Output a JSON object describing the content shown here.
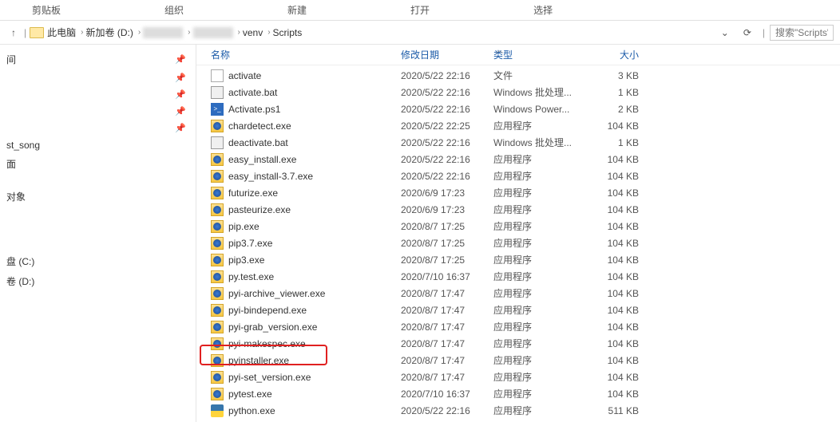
{
  "ribbon": [
    "剪贴板",
    "组织",
    "新建",
    "打开",
    "选择"
  ],
  "nav": {
    "segments": [
      "此电脑",
      "新加卷 (D:)",
      "",
      "",
      "venv",
      "Scripts"
    ],
    "search_placeholder": "搜索\"Scripts\""
  },
  "sidebar": {
    "items": [
      {
        "label": "间",
        "pin": true
      },
      {
        "label": "",
        "pin": true
      },
      {
        "label": "",
        "pin": true
      },
      {
        "label": "",
        "pin": true
      },
      {
        "label": "",
        "pin": true
      },
      {
        "label": "st_song",
        "pin": false
      },
      {
        "label": "面",
        "pin": false
      },
      {
        "label": "",
        "pin": false
      },
      {
        "label": "",
        "pin": false
      },
      {
        "label": "对象",
        "pin": false
      },
      {
        "label": "",
        "pin": false
      },
      {
        "label": "",
        "pin": false
      },
      {
        "label": "",
        "pin": false
      },
      {
        "label": "",
        "pin": false
      },
      {
        "label": "",
        "pin": false
      },
      {
        "label": "",
        "pin": false
      },
      {
        "label": "",
        "pin": false
      },
      {
        "label": "盘 (C:)",
        "pin": false
      },
      {
        "label": "卷 (D:)",
        "pin": false
      }
    ]
  },
  "columns": {
    "name": "名称",
    "date": "修改日期",
    "type": "类型",
    "size": "大小"
  },
  "files": [
    {
      "icon": "file",
      "name": "activate",
      "date": "2020/5/22 22:16",
      "type": "文件",
      "size": "3 KB"
    },
    {
      "icon": "bat",
      "name": "activate.bat",
      "date": "2020/5/22 22:16",
      "type": "Windows 批处理...",
      "size": "1 KB"
    },
    {
      "icon": "ps1",
      "name": "Activate.ps1",
      "date": "2020/5/22 22:16",
      "type": "Windows Power...",
      "size": "2 KB"
    },
    {
      "icon": "exe",
      "name": "chardetect.exe",
      "date": "2020/5/22 22:25",
      "type": "应用程序",
      "size": "104 KB"
    },
    {
      "icon": "bat",
      "name": "deactivate.bat",
      "date": "2020/5/22 22:16",
      "type": "Windows 批处理...",
      "size": "1 KB"
    },
    {
      "icon": "exe",
      "name": "easy_install.exe",
      "date": "2020/5/22 22:16",
      "type": "应用程序",
      "size": "104 KB"
    },
    {
      "icon": "exe",
      "name": "easy_install-3.7.exe",
      "date": "2020/5/22 22:16",
      "type": "应用程序",
      "size": "104 KB"
    },
    {
      "icon": "exe",
      "name": "futurize.exe",
      "date": "2020/6/9 17:23",
      "type": "应用程序",
      "size": "104 KB"
    },
    {
      "icon": "exe",
      "name": "pasteurize.exe",
      "date": "2020/6/9 17:23",
      "type": "应用程序",
      "size": "104 KB"
    },
    {
      "icon": "exe",
      "name": "pip.exe",
      "date": "2020/8/7 17:25",
      "type": "应用程序",
      "size": "104 KB"
    },
    {
      "icon": "exe",
      "name": "pip3.7.exe",
      "date": "2020/8/7 17:25",
      "type": "应用程序",
      "size": "104 KB"
    },
    {
      "icon": "exe",
      "name": "pip3.exe",
      "date": "2020/8/7 17:25",
      "type": "应用程序",
      "size": "104 KB"
    },
    {
      "icon": "exe",
      "name": "py.test.exe",
      "date": "2020/7/10 16:37",
      "type": "应用程序",
      "size": "104 KB"
    },
    {
      "icon": "exe",
      "name": "pyi-archive_viewer.exe",
      "date": "2020/8/7 17:47",
      "type": "应用程序",
      "size": "104 KB"
    },
    {
      "icon": "exe",
      "name": "pyi-bindepend.exe",
      "date": "2020/8/7 17:47",
      "type": "应用程序",
      "size": "104 KB"
    },
    {
      "icon": "exe",
      "name": "pyi-grab_version.exe",
      "date": "2020/8/7 17:47",
      "type": "应用程序",
      "size": "104 KB"
    },
    {
      "icon": "exe",
      "name": "pyi-makespec.exe",
      "date": "2020/8/7 17:47",
      "type": "应用程序",
      "size": "104 KB"
    },
    {
      "icon": "exe",
      "name": "pyinstaller.exe",
      "date": "2020/8/7 17:47",
      "type": "应用程序",
      "size": "104 KB",
      "highlight": true
    },
    {
      "icon": "exe",
      "name": "pyi-set_version.exe",
      "date": "2020/8/7 17:47",
      "type": "应用程序",
      "size": "104 KB"
    },
    {
      "icon": "exe",
      "name": "pytest.exe",
      "date": "2020/7/10 16:37",
      "type": "应用程序",
      "size": "104 KB"
    },
    {
      "icon": "py",
      "name": "python.exe",
      "date": "2020/5/22 22:16",
      "type": "应用程序",
      "size": "511 KB"
    }
  ]
}
